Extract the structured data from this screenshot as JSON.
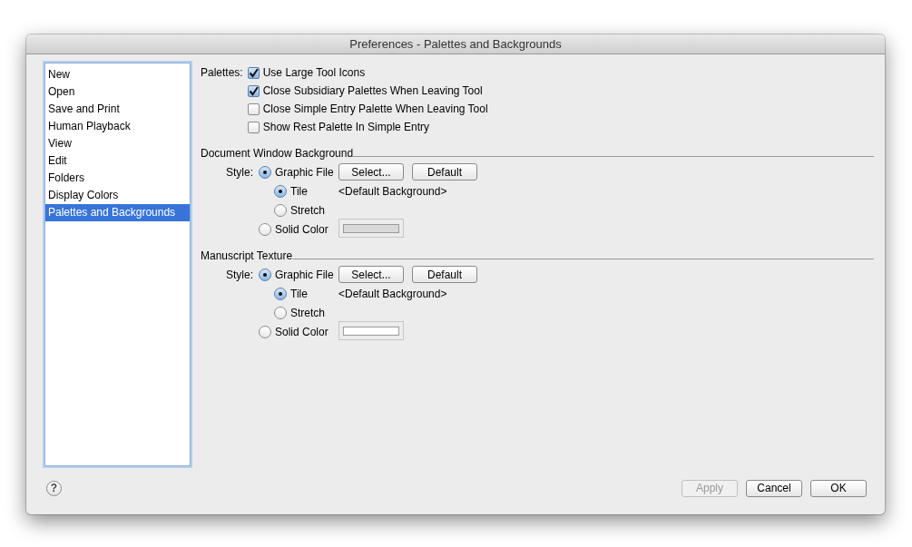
{
  "window": {
    "title": "Preferences - Palettes and Backgrounds"
  },
  "sidebar": {
    "items": [
      {
        "label": "New",
        "selected": false
      },
      {
        "label": "Open",
        "selected": false
      },
      {
        "label": "Save and Print",
        "selected": false
      },
      {
        "label": "Human Playback",
        "selected": false
      },
      {
        "label": "View",
        "selected": false
      },
      {
        "label": "Edit",
        "selected": false
      },
      {
        "label": "Folders",
        "selected": false
      },
      {
        "label": "Display Colors",
        "selected": false
      },
      {
        "label": "Palettes and Backgrounds",
        "selected": true
      }
    ]
  },
  "palettes": {
    "label": "Palettes:",
    "options": [
      {
        "label": "Use Large Tool Icons",
        "checked": true
      },
      {
        "label": "Close Subsidiary Palettes When Leaving Tool",
        "checked": true
      },
      {
        "label": "Close Simple Entry Palette When Leaving Tool",
        "checked": false
      },
      {
        "label": "Show Rest Palette In Simple Entry",
        "checked": false
      }
    ]
  },
  "sections": [
    {
      "title": "Document Window Background",
      "style_label": "Style:",
      "graphic_file": {
        "label": "Graphic File",
        "selected": true
      },
      "buttons": [
        "Select...",
        "Default"
      ],
      "modes": [
        {
          "label": "Tile",
          "selected": true
        },
        {
          "label": "Stretch",
          "selected": false
        }
      ],
      "file_name": "<Default Background>",
      "solid_color": {
        "label": "Solid Color",
        "selected": false
      },
      "color": "#d9d9d9"
    },
    {
      "title": "Manuscript Texture",
      "style_label": "Style:",
      "graphic_file": {
        "label": "Graphic File",
        "selected": true
      },
      "buttons": [
        "Select...",
        "Default"
      ],
      "modes": [
        {
          "label": "Tile",
          "selected": true
        },
        {
          "label": "Stretch",
          "selected": false
        }
      ],
      "file_name": "<Default Background>",
      "solid_color": {
        "label": "Solid Color",
        "selected": false
      },
      "color": "#ffffff"
    }
  ],
  "help_button": "?",
  "buttons": [
    {
      "label": "Apply",
      "disabled": true
    },
    {
      "label": "Cancel",
      "disabled": false
    },
    {
      "label": "OK",
      "disabled": false
    }
  ]
}
